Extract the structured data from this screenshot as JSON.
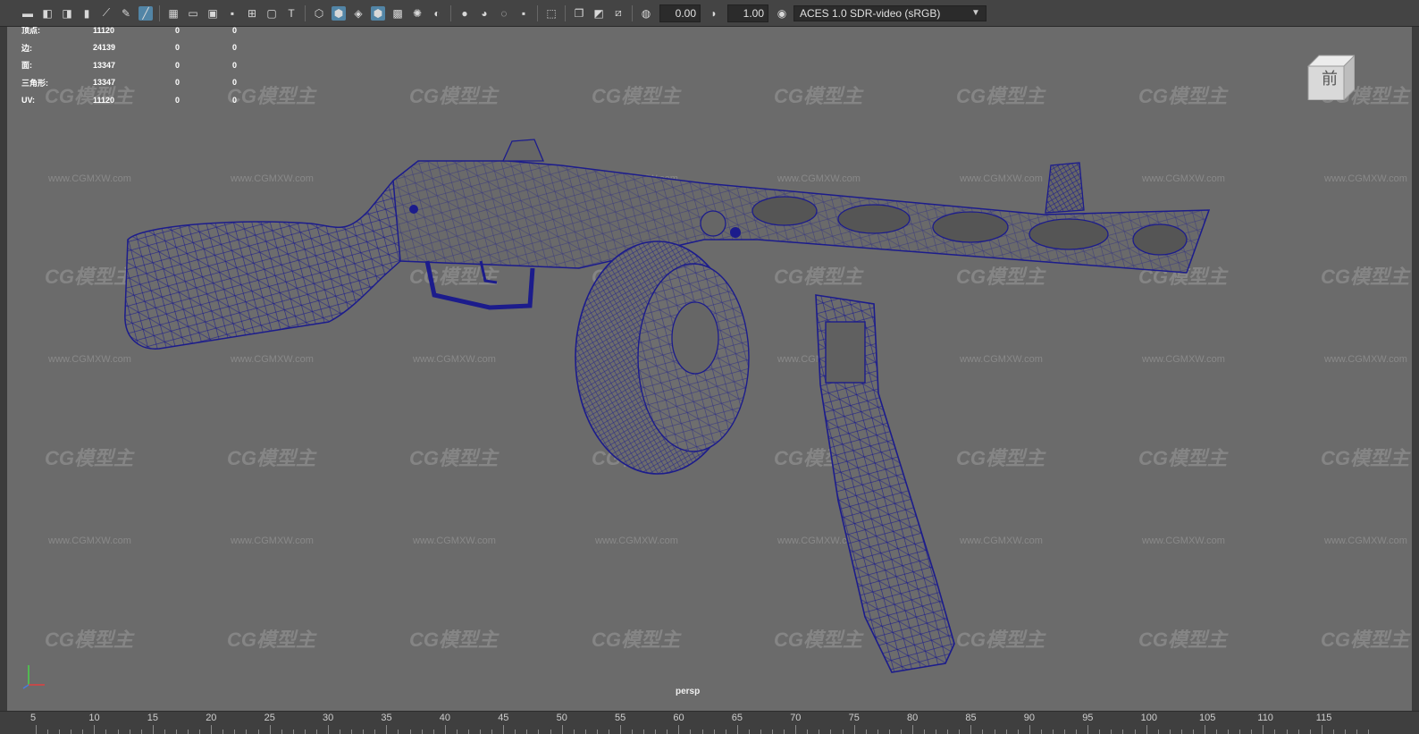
{
  "toolbar": {
    "exposure_value": "0.00",
    "gamma_value": "1.00",
    "color_management": "ACES 1.0 SDR-video (sRGB)"
  },
  "hud": {
    "rows": [
      {
        "label": "顶点:",
        "v1": "11120",
        "v2": "0",
        "v3": "0"
      },
      {
        "label": "边:",
        "v1": "24139",
        "v2": "0",
        "v3": "0"
      },
      {
        "label": "面:",
        "v1": "13347",
        "v2": "0",
        "v3": "0"
      },
      {
        "label": "三角形:",
        "v1": "13347",
        "v2": "0",
        "v3": "0"
      },
      {
        "label": "UV:",
        "v1": "11120",
        "v2": "0",
        "v3": "0"
      }
    ]
  },
  "viewcube_label": "前",
  "watermark_text": "CG模型主",
  "watermark_url": "www.CGMXW.com",
  "camera_label": "persp",
  "timeline": {
    "labels": [
      "5",
      "10",
      "15",
      "20",
      "25",
      "30",
      "35",
      "40",
      "45",
      "50",
      "55",
      "60",
      "65",
      "70",
      "75",
      "80",
      "85",
      "90",
      "95",
      "100",
      "105",
      "110",
      "115"
    ]
  },
  "colors": {
    "wireframe": "#1c1c8c",
    "viewport_bg": "#6b6b6b",
    "active_icon": "#5285a6"
  }
}
